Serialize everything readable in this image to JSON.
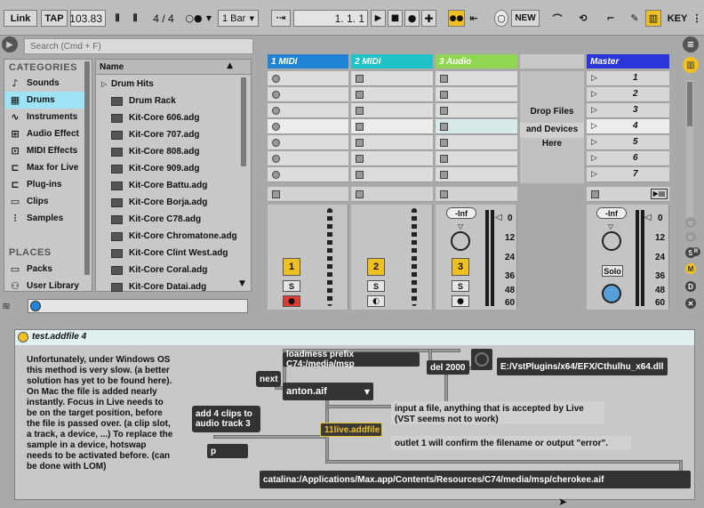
{
  "toolbar": {
    "link": "Link",
    "tap": "TAP",
    "tempo": "103.83",
    "time_sig_num": "4",
    "time_sig_slash": "/",
    "time_sig_den": "4",
    "quantize": "1 Bar",
    "position": "1.   1.   1",
    "new": "NEW",
    "key": "KEY"
  },
  "browser": {
    "search_placeholder": "Search (Cmd + F)",
    "categories_title": "CATEGORIES",
    "categories": [
      {
        "label": "Sounds",
        "icon": "note-icon"
      },
      {
        "label": "Drums",
        "icon": "drums-grid-icon"
      },
      {
        "label": "Instruments",
        "icon": "instrument-wave-icon"
      },
      {
        "label": "Audio Effect",
        "icon": "audio-effect-icon"
      },
      {
        "label": "MIDI Effects",
        "icon": "midi-effect-icon"
      },
      {
        "label": "Max for Live",
        "icon": "max-icon"
      },
      {
        "label": "Plug-ins",
        "icon": "plugin-icon"
      },
      {
        "label": "Clips",
        "icon": "clip-icon"
      },
      {
        "label": "Samples",
        "icon": "sample-icon"
      }
    ],
    "places_title": "PLACES",
    "places": [
      {
        "label": "Packs",
        "icon": "packs-icon"
      },
      {
        "label": "User Library",
        "icon": "user-library-icon"
      }
    ],
    "list_header": "Name",
    "folder": "Drum Hits",
    "items": [
      "Drum Rack",
      "Kit-Core 606.adg",
      "Kit-Core 707.adg",
      "Kit-Core 808.adg",
      "Kit-Core 909.adg",
      "Kit-Core Battu.adg",
      "Kit-Core Borja.adg",
      "Kit-Core C78.adg",
      "Kit-Core Chromatone.adg",
      "Kit-Core Clint West.adg",
      "Kit-Core Coral.adg",
      "Kit-Core Datai.adg"
    ]
  },
  "session": {
    "tracks": [
      {
        "name": "1 MIDI",
        "color": "#1f84d6",
        "number": "1",
        "solo": "S"
      },
      {
        "name": "2 MIDI",
        "color": "#1ec2c7",
        "number": "2",
        "solo": "S"
      },
      {
        "name": "3 Audio",
        "color": "#8fd651",
        "number": "3",
        "solo": "S"
      }
    ],
    "master": {
      "name": "Master",
      "color": "#2a35d9",
      "solo": "Solo"
    },
    "drop_line1": "Drop Files",
    "drop_line2": "and Devices",
    "drop_line3": "Here",
    "scenes": [
      "1",
      "2",
      "3",
      "4",
      "5",
      "6",
      "7"
    ],
    "volume_label": "-Inf",
    "db_marks": [
      "0",
      "12",
      "24",
      "36",
      "48",
      "60"
    ]
  },
  "device": {
    "title": "test.addfile 4",
    "comment_main": "Unfortunately, under Windows OS this method is very slow. (a better solution has yet to be found here). On Mac the file is added nearly instantly. Focus in Live needs to be on the target position, before the file is passed over. (a clip slot, a track, a device, ...) To replace the sample in a device, hotswap needs to be activated before. (can be done with LOM)",
    "loadmess": "loadmess prefix C74:/media/msp",
    "next": "next",
    "menu_value": "anton.aif",
    "del": "del 2000",
    "path_plugin": "E:/VstPlugins/x64/EFX/Cthulhu_x64.dll",
    "add_clips": "add 4 clips to audio track 3",
    "p": "p",
    "addfile": "11live.addfile",
    "input_comment": "input a file, anything that is accepted by Live (VST seems not to work)",
    "outlet_comment": "outlet 1 will confirm the filename or output \"error\".",
    "path_output": "catalina:/Applications/Max.app/Contents/Resources/C74/media/msp/cherokee.aif"
  }
}
